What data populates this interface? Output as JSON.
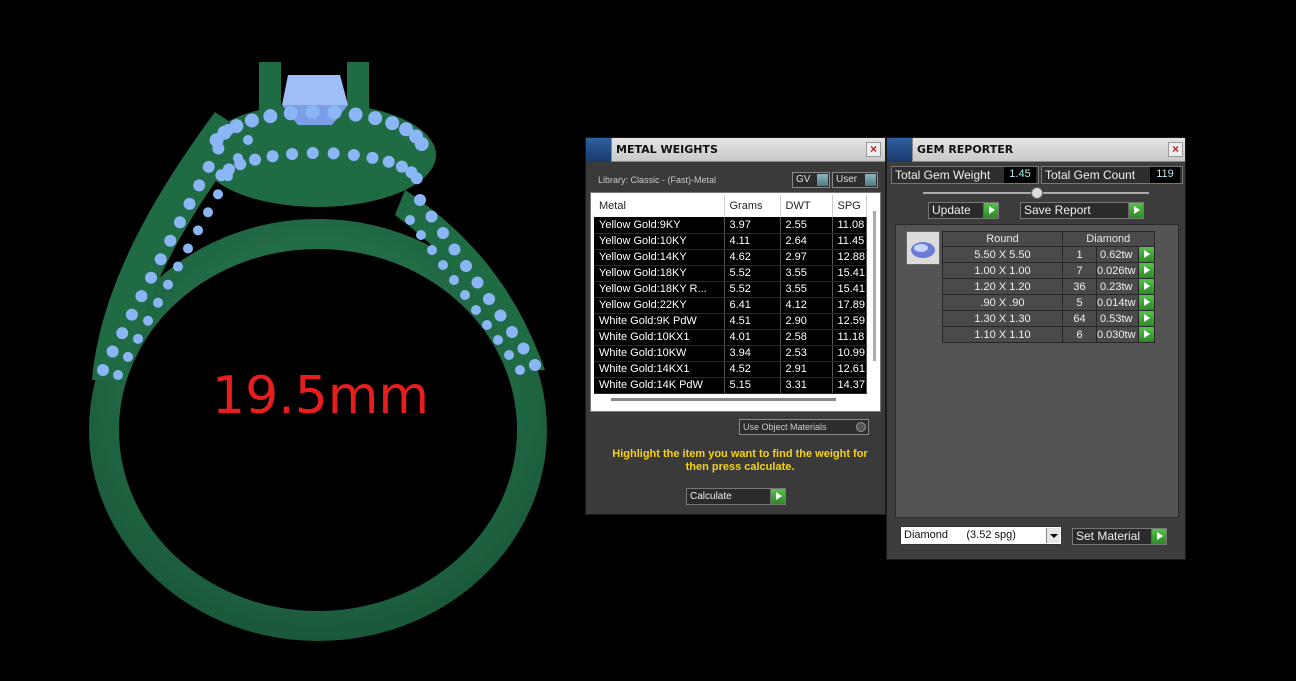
{
  "viewport": {
    "ring_size_label": "19.5mm",
    "colors": {
      "metal": "#1f6b44",
      "gem": "#7fb0f5",
      "label": "#e81d1d"
    }
  },
  "metal_weights": {
    "title": "METAL WEIGHTS",
    "library_label": "Library: Classic - (Fast)-Metal",
    "toggle_gv": "GV",
    "toggle_user": "User",
    "columns": [
      "Metal",
      "Grams",
      "DWT",
      "SPG"
    ],
    "rows": [
      [
        "Yellow Gold:9KY",
        "3.97",
        "2.55",
        "11.08"
      ],
      [
        "Yellow Gold:10KY",
        "4.11",
        "2.64",
        "11.45"
      ],
      [
        "Yellow Gold:14KY",
        "4.62",
        "2.97",
        "12.88"
      ],
      [
        "Yellow Gold:18KY",
        "5.52",
        "3.55",
        "15.41"
      ],
      [
        "Yellow Gold:18KY R...",
        "5.52",
        "3.55",
        "15.41"
      ],
      [
        "Yellow Gold:22KY",
        "6.41",
        "4.12",
        "17.89"
      ],
      [
        "White Gold:9K PdW",
        "4.51",
        "2.90",
        "12.59"
      ],
      [
        "White Gold:10KX1",
        "4.01",
        "2.58",
        "11.18"
      ],
      [
        "White Gold:10KW",
        "3.94",
        "2.53",
        "10.99"
      ],
      [
        "White Gold:14KX1",
        "4.52",
        "2.91",
        "12.61"
      ],
      [
        "White Gold:14K PdW",
        "5.15",
        "3.31",
        "14.37"
      ]
    ],
    "use_object_materials": "Use Object Materials",
    "hint": "Highlight the item you want to find the weight for then press calculate.",
    "calculate_label": "Calculate"
  },
  "gem_reporter": {
    "title": "GEM REPORTER",
    "total_weight_label": "Total Gem Weight",
    "total_weight_value": "1.45",
    "total_count_label": "Total Gem Count",
    "total_count_value": "119",
    "update_label": "Update",
    "save_report_label": "Save Report",
    "table_header": [
      "Round",
      "Diamond"
    ],
    "rows": [
      [
        "5.50 X 5.50",
        "1",
        "0.62tw"
      ],
      [
        "1.00 X 1.00",
        "7",
        "0.026tw"
      ],
      [
        "1.20 X 1.20",
        "36",
        "0.23tw"
      ],
      [
        ".90 X .90",
        "5",
        "0.014tw"
      ],
      [
        "1.30 X 1.30",
        "64",
        "0.53tw"
      ],
      [
        "1.10 X 1.10",
        "6",
        "0.030tw"
      ]
    ],
    "material_select": "Diamond      (3.52 spg)",
    "set_material_label": "Set Material"
  }
}
